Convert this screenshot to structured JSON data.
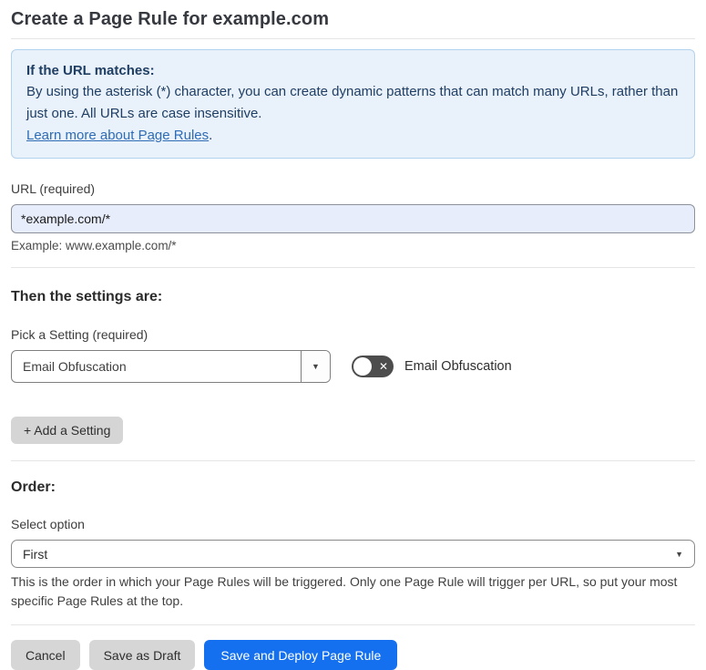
{
  "page": {
    "title": "Create a Page Rule for example.com"
  },
  "info_box": {
    "heading": "If the URL matches:",
    "body": "By using the asterisk (*) character, you can create dynamic patterns that can match many URLs, rather than just one. All URLs are case insensitive.",
    "link_text": "Learn more about Page Rules",
    "link_suffix": "."
  },
  "url_field": {
    "label": "URL (required)",
    "value": "*example.com/*",
    "example": "Example: www.example.com/*"
  },
  "settings_section": {
    "heading": "Then the settings are:",
    "picker_label": "Pick a Setting (required)",
    "picker_value": "Email Obfuscation",
    "toggle_label": "Email Obfuscation",
    "toggle_state": "off",
    "add_button_label": "+ Add a Setting"
  },
  "order_section": {
    "heading": "Order:",
    "select_label": "Select option",
    "select_value": "First",
    "help_text": "This is the order in which your Page Rules will be triggered. Only one Page Rule will trigger per URL, so put your most specific Page Rules at the top."
  },
  "footer": {
    "cancel_label": "Cancel",
    "save_draft_label": "Save as Draft",
    "save_deploy_label": "Save and Deploy Page Rule"
  },
  "icons": {
    "dropdown_arrow": "▼",
    "chevron_down": "▼",
    "toggle_off_x": "✕"
  },
  "colors": {
    "info_bg": "#e9f1fa",
    "info_border": "#b3d2ed",
    "info_text": "#1f3e63",
    "link_blue": "#2e6cb5",
    "input_bg": "#e7edfa",
    "primary_blue": "#1570f0",
    "toggle_off_bg": "#4d4d4d",
    "gray_button_bg": "#d6d6d6"
  }
}
